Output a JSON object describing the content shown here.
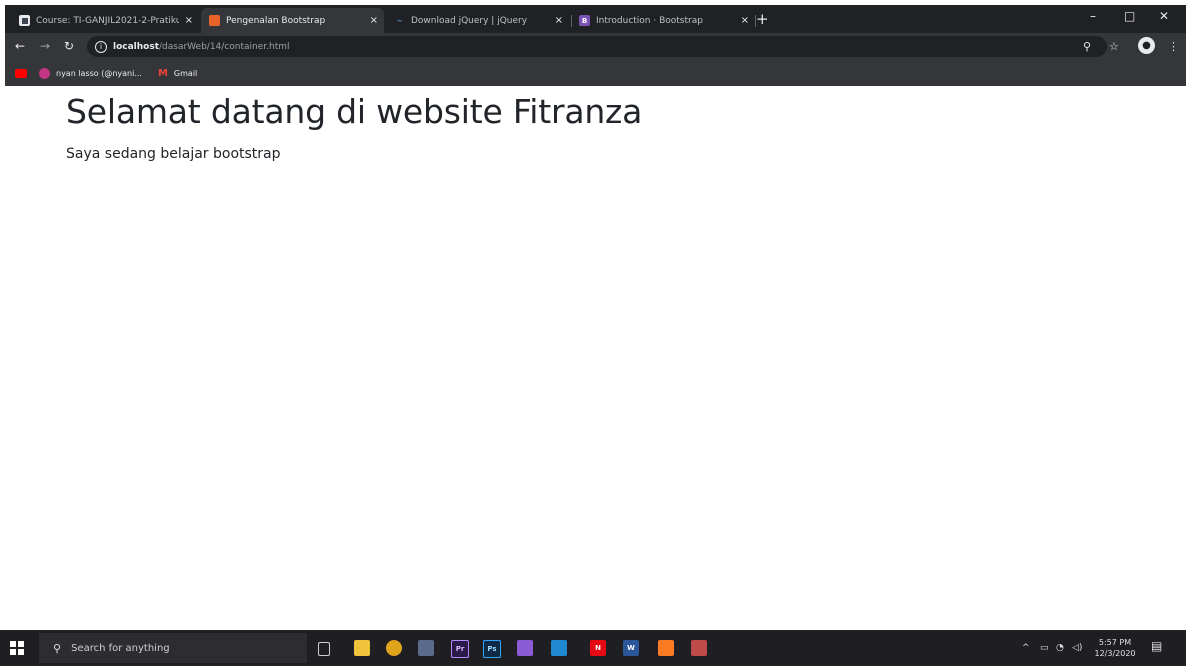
{
  "browser": {
    "tabs": [
      {
        "title": "Course: TI-GANJIL2021-2-Pratiku",
        "icon": "moodle-icon",
        "color": "#3d4553",
        "active": false
      },
      {
        "title": "Pengenalan Bootstrap",
        "icon": "html-file-icon",
        "color": "#e96228",
        "active": true
      },
      {
        "title": "Download jQuery | jQuery",
        "icon": "jquery-icon",
        "color": "#0769ad",
        "active": false
      },
      {
        "title": "Introduction · Bootstrap",
        "icon": "bootstrap-icon",
        "color": "#7952b3",
        "active": false
      }
    ],
    "close_glyph": "×",
    "new_tab_glyph": "+",
    "address": {
      "host": "localhost",
      "path": "/dasarWeb/14/container.html"
    },
    "bookmarks": [
      {
        "label": "",
        "icon": "youtube-icon",
        "color": "#ff0000"
      },
      {
        "label": "nyan lasso (@nyani...",
        "icon": "instagram-icon",
        "color": "#c13584"
      },
      {
        "label": "Gmail",
        "icon": "gmail-icon",
        "color": "#ea4335"
      }
    ]
  },
  "page": {
    "title": "Selamat datang di website Fitranza",
    "lead": "Saya sedang belajar bootstrap"
  },
  "taskbar": {
    "search_placeholder": "Search for anything",
    "apps": [
      {
        "name": "task-view-icon",
        "color": "#1f1f23",
        "glyph": ""
      },
      {
        "name": "file-explorer-icon",
        "color": "#f0c33c",
        "glyph": ""
      },
      {
        "name": "chrome-icon",
        "color": "#e0a41c",
        "glyph": ""
      },
      {
        "name": "app-icon",
        "color": "#5a6b8c",
        "glyph": ""
      },
      {
        "name": "premiere-icon",
        "color": "#2a1a4a",
        "glyph": "Pr"
      },
      {
        "name": "photoshop-icon",
        "color": "#0f2a44",
        "glyph": "Ps"
      },
      {
        "name": "visual-studio-icon",
        "color": "#8b5cd6",
        "glyph": ""
      },
      {
        "name": "vscode-icon",
        "color": "#1f8ad2",
        "glyph": ""
      },
      {
        "name": "netflix-icon",
        "color": "#e50914",
        "glyph": "N"
      },
      {
        "name": "word-icon",
        "color": "#2b579a",
        "glyph": "W"
      },
      {
        "name": "xampp-icon",
        "color": "#fb7a24",
        "glyph": ""
      },
      {
        "name": "snipping-tool-icon",
        "color": "#c04a4a",
        "glyph": ""
      }
    ],
    "time": "5:57 PM",
    "date": "12/3/2020"
  }
}
